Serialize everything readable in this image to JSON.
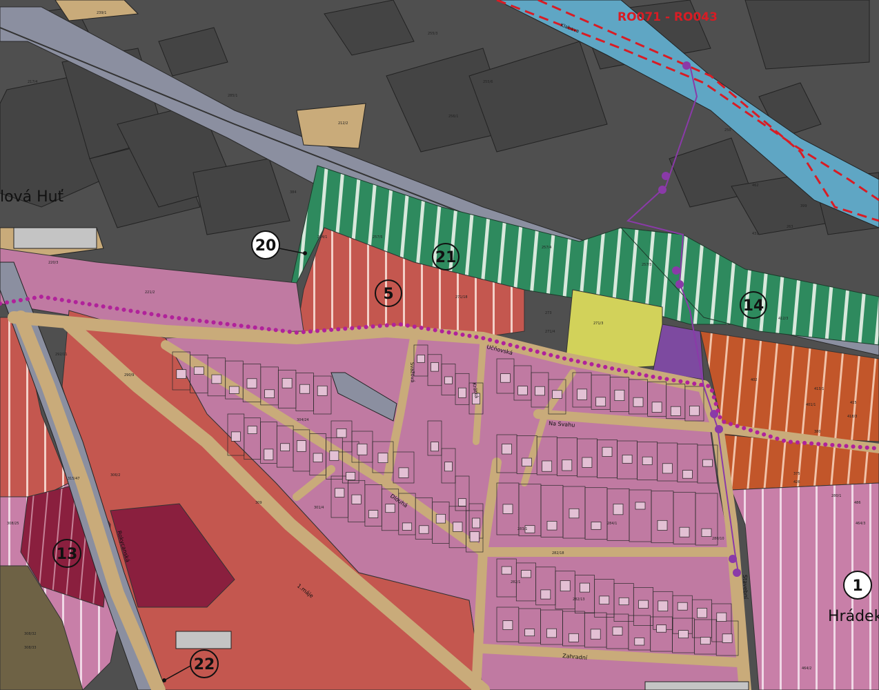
{
  "map": {
    "route_label": "RO071 - RO043",
    "river_label": "Klabava",
    "place_labels": {
      "nova_hut": "lová Huť",
      "hradek": "Hrádek"
    },
    "zones": [
      {
        "id": "z20",
        "number": "20"
      },
      {
        "id": "z21",
        "number": "21"
      },
      {
        "id": "z5",
        "number": "5"
      },
      {
        "id": "z14",
        "number": "14"
      },
      {
        "id": "z13",
        "number": "13"
      },
      {
        "id": "z22",
        "number": "22"
      },
      {
        "id": "z1",
        "number": "1"
      }
    ],
    "streets": {
      "ucnovska": "Učňovská",
      "na_svahu": "Na Svahu",
      "dlouha": "Dlouhá",
      "stavebni": "Stavební",
      "zahradni": "Zahradní",
      "prvni_maje": "1.máje",
      "rokycanska": "Rokycanská",
      "svazova": "Svažová",
      "kratka": "Krátká"
    },
    "parcel_labels": [
      "239/1",
      "255/3",
      "256/1",
      "217/4",
      "212/2",
      "255/6",
      "220/3",
      "221/2",
      "224/1",
      "257/5",
      "257/4",
      "257/3",
      "271/18",
      "271/4",
      "280/1",
      "402",
      "401/1",
      "412/3",
      "413/1",
      "415",
      "418/3",
      "380",
      "375",
      "290/9",
      "292/11",
      "315/47",
      "308/25",
      "306/2",
      "308/32",
      "308/33",
      "309",
      "304/24",
      "301/4",
      "282/18",
      "280/10",
      "282/13",
      "282/1",
      "283/1",
      "284/1",
      "426",
      "273",
      "271/3",
      "431",
      "462",
      "263",
      "250",
      "399",
      "486",
      "464/3",
      "464/2",
      "285/1",
      "384"
    ],
    "colors": {
      "industrial": "#4f4f4f",
      "industrial_bldg": "#3a3a3a",
      "rail": "#8b8fa0",
      "residential": "#c07aa2",
      "mixed": "#c4574f",
      "green": "#2e8a5e",
      "river": "#5fa6c4",
      "road": "#c9ab7a",
      "orange": "#c2562a",
      "yellow": "#d2d25a",
      "purple": "#7d4aa0",
      "maroon": "#8a1f3e",
      "olive": "#6e6245",
      "pink_light": "#d8a8c8",
      "boundary_dots": "#b0229a",
      "route_red": "#d81c24"
    }
  }
}
